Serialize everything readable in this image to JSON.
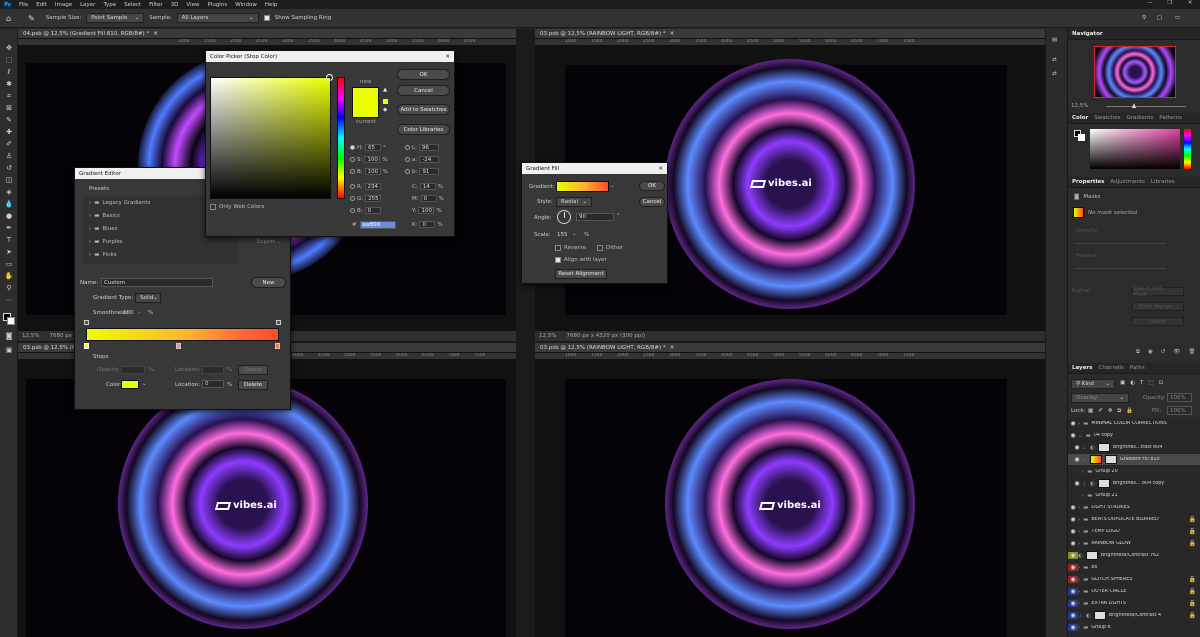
{
  "menu": {
    "app_icon": "Ps",
    "items": [
      "File",
      "Edit",
      "Image",
      "Layer",
      "Type",
      "Select",
      "Filter",
      "3D",
      "View",
      "Plugins",
      "Window",
      "Help"
    ]
  },
  "options": {
    "sample_size_label": "Sample Size:",
    "sample_size_value": "Point Sample",
    "sample_label": "Sample:",
    "sample_value": "All Layers",
    "show_ring_label": "Show Sampling Ring"
  },
  "documents": [
    {
      "tab": "04.psb @ 12,5% (Gradient Fill 810, RGB/8#) *",
      "zoom": "12,5%",
      "info": "7680 px x 4320 px (300 ppi)"
    },
    {
      "tab": "03.psb @ 12,5% (RAINBOW LIGHT, RGB/8#) *",
      "zoom": "12,5%",
      "info": "7680 px x 4320 px (300 ppi)"
    },
    {
      "tab": "03.psb @ 12,5% (RAI...",
      "zoom": "",
      "info": ""
    },
    {
      "tab": "03.psb @ 12,5% (RAINBOW LIGHT, RGB/8#) *",
      "zoom": "",
      "info": ""
    }
  ],
  "ruler_ticks": [
    "1000",
    "1500",
    "2000",
    "2500",
    "3000",
    "3500",
    "4000",
    "4500",
    "5000",
    "5500",
    "6000",
    "6500",
    "7000",
    "7500"
  ],
  "logo_text": "vibes.ai",
  "color_picker": {
    "title": "Color Picker (Stop Color)",
    "ok": "OK",
    "cancel": "Cancel",
    "add_swatches": "Add to Swatches",
    "color_libraries": "Color Libraries",
    "new_label": "new",
    "current_label": "current",
    "H": "65",
    "S": "100",
    "B": "100",
    "R": "234",
    "G": "255",
    "Bl": "0",
    "L": "96",
    "a": "-24",
    "b": "91",
    "C": "14",
    "M": "0",
    "Y": "100",
    "K": "0",
    "deg": "°",
    "pct": "%",
    "hex": "eaff00",
    "only_web": "Only Web Colors",
    "new_color": "#eaff00",
    "current_color": "#eaff00"
  },
  "gradient_editor": {
    "title": "Gradient Editor",
    "presets_label": "Presets",
    "folders": [
      "Legacy Gradients",
      "Basics",
      "Blues",
      "Purples",
      "Pinks"
    ],
    "export": "Export...",
    "name_label": "Name:",
    "name_value": "Custom",
    "new_btn": "New",
    "gradient_type_label": "Gradient Type:",
    "gradient_type_value": "Solid",
    "smoothness_label": "Smoothness:",
    "smoothness_value": "100",
    "stops_label": "Stops",
    "opacity_label": "Opacity:",
    "location_label": "Location:",
    "delete": "Delete",
    "color_label": "Color:",
    "location_value": "0",
    "pct": "%"
  },
  "gradient_fill": {
    "title": "Gradient Fill",
    "gradient_label": "Gradient:",
    "ok": "OK",
    "cancel": "Cancel",
    "style_label": "Style:",
    "style_value": "Radial",
    "angle_label": "Angle:",
    "angle_value": "90",
    "deg": "°",
    "scale_label": "Scale:",
    "scale_value": "155",
    "pct": "%",
    "reverse": "Reverse",
    "dither": "Dither",
    "align": "Align with layer",
    "reset": "Reset Alignment"
  },
  "navigator": {
    "title": "Navigator",
    "zoom": "12,5%"
  },
  "color_panel": {
    "tabs": [
      "Color",
      "Swatches",
      "Gradients",
      "Patterns"
    ]
  },
  "properties": {
    "tabs": [
      "Properties",
      "Adjustments",
      "Libraries"
    ],
    "masks": "Masks",
    "no_mask": "No mask selected",
    "density": "Density:",
    "feather": "Feather:",
    "refine": "Refine:",
    "select_mask": "Select and Mask...",
    "color_range": "Color Range...",
    "invert": "Invert"
  },
  "layers_panel": {
    "tabs": [
      "Layers",
      "Channels",
      "Paths"
    ],
    "kind": "Kind",
    "blend": "Overlay",
    "opacity_label": "Opacity:",
    "opacity": "100%",
    "lock_label": "Lock:",
    "fill_label": "Fill:",
    "fill": "100%",
    "layers": [
      {
        "name": "MINIMAL COLOR CORRECTIONS",
        "type": "group"
      },
      {
        "name": "04 copy",
        "type": "group"
      },
      {
        "name": "Brightnes...trast 804",
        "type": "adj"
      },
      {
        "name": "Gradient Fill 810",
        "type": "adj"
      },
      {
        "name": "Group 20",
        "type": "group"
      },
      {
        "name": "Brightnes... 804 copy",
        "type": "adj"
      },
      {
        "name": "Group 21",
        "type": "group"
      },
      {
        "name": "LIGHT STROKES",
        "type": "group"
      },
      {
        "name": "BEATS DUPLICATE BLURRED",
        "type": "group"
      },
      {
        "name": "TEMP LOGO",
        "type": "group"
      },
      {
        "name": "RAINBOW GLOW",
        "type": "group"
      },
      {
        "name": "Brightness/Contrast 762",
        "type": "adj"
      },
      {
        "name": "bx",
        "type": "group"
      },
      {
        "name": "GLITCH SPHERES",
        "type": "group"
      },
      {
        "name": "OUTER CIRCLE",
        "type": "group"
      },
      {
        "name": "EXTRA LIGHTS",
        "type": "group"
      },
      {
        "name": "Brightness/Contrast 4",
        "type": "adj"
      },
      {
        "name": "Group 6",
        "type": "group"
      }
    ]
  }
}
